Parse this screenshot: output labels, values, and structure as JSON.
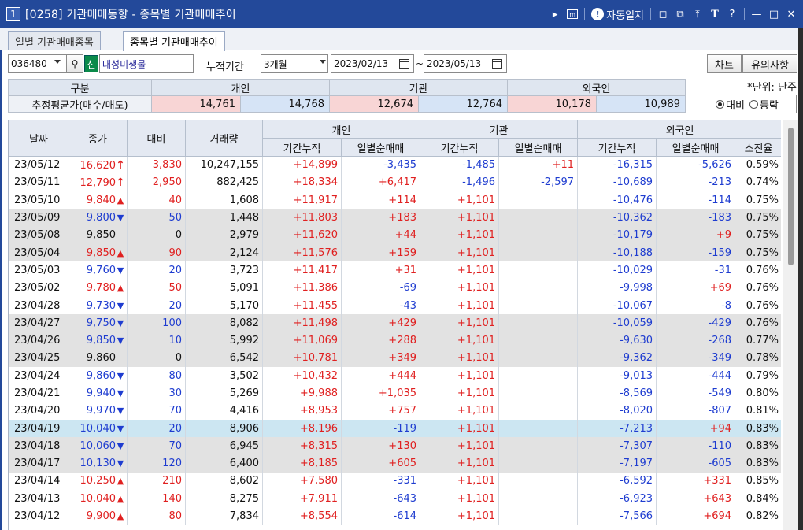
{
  "window": {
    "number": "1",
    "title": "[0258] 기관매매동향 - 종목별 기관매매추이",
    "auto_journal_label": "자동일지",
    "font_label": "T",
    "help_label": "?"
  },
  "tabs": [
    {
      "label": "일별 기관매매종목",
      "active": false
    },
    {
      "label": "종목별 기관매매추이",
      "active": true
    }
  ],
  "controls": {
    "stock_code": "036480",
    "credit_badge": "신",
    "stock_name": "대성미생물",
    "period_label": "누적기간",
    "period_value": "3개월",
    "date_from": "2023/02/13",
    "date_sep": "~",
    "date_to": "2023/05/13",
    "chart_button": "차트",
    "notes_button": "유의사항"
  },
  "summary": {
    "col_header": "구분",
    "row_label": "추정평균가(매수/매도)",
    "groups": [
      "개인",
      "기관",
      "외국인"
    ],
    "values": [
      {
        "buy": "14,761",
        "sell": "14,768"
      },
      {
        "buy": "12,674",
        "sell": "12,764"
      },
      {
        "buy": "10,178",
        "sell": "10,989"
      }
    ],
    "unit": "*단위: 단주",
    "radio_compare": "대비",
    "radio_change": "등락"
  },
  "grid": {
    "headers": {
      "date": "날짜",
      "close": "종가",
      "diff": "대비",
      "volume": "거래량",
      "individual": "개인",
      "institution": "기관",
      "foreign": "외국인",
      "cumulative": "기간누적",
      "daily_net": "일별순매매",
      "exhaustion": "소진율"
    },
    "rows": [
      {
        "date": "23/05/12",
        "close": "16,620",
        "dir": "upper",
        "diff": "3,830",
        "vol": "10,247,155",
        "ind_cum": "+14,899",
        "ind_day": "-3,435",
        "inst_cum": "-1,485",
        "inst_day": "+11",
        "for_cum": "-16,315",
        "for_day": "-5,626",
        "exh": "0.59%",
        "shade": "white"
      },
      {
        "date": "23/05/11",
        "close": "12,790",
        "dir": "upper",
        "diff": "2,950",
        "vol": "882,425",
        "ind_cum": "+18,334",
        "ind_day": "+6,417",
        "inst_cum": "-1,496",
        "inst_day": "-2,597",
        "for_cum": "-10,689",
        "for_day": "-213",
        "exh": "0.74%",
        "shade": "white"
      },
      {
        "date": "23/05/10",
        "close": "9,840",
        "dir": "up",
        "diff": "40",
        "vol": "1,608",
        "ind_cum": "+11,917",
        "ind_day": "+114",
        "inst_cum": "+1,101",
        "inst_day": "",
        "for_cum": "-10,476",
        "for_day": "-114",
        "exh": "0.75%",
        "shade": "white"
      },
      {
        "date": "23/05/09",
        "close": "9,800",
        "dir": "down",
        "diff": "50",
        "vol": "1,448",
        "ind_cum": "+11,803",
        "ind_day": "+183",
        "inst_cum": "+1,101",
        "inst_day": "",
        "for_cum": "-10,362",
        "for_day": "-183",
        "exh": "0.75%",
        "shade": "gray"
      },
      {
        "date": "23/05/08",
        "close": "9,850",
        "dir": "flat",
        "diff": "0",
        "vol": "2,979",
        "ind_cum": "+11,620",
        "ind_day": "+44",
        "inst_cum": "+1,101",
        "inst_day": "",
        "for_cum": "-10,179",
        "for_day": "+9",
        "exh": "0.75%",
        "shade": "gray"
      },
      {
        "date": "23/05/04",
        "close": "9,850",
        "dir": "up",
        "diff": "90",
        "vol": "2,124",
        "ind_cum": "+11,576",
        "ind_day": "+159",
        "inst_cum": "+1,101",
        "inst_day": "",
        "for_cum": "-10,188",
        "for_day": "-159",
        "exh": "0.75%",
        "shade": "gray"
      },
      {
        "date": "23/05/03",
        "close": "9,760",
        "dir": "down",
        "diff": "20",
        "vol": "3,723",
        "ind_cum": "+11,417",
        "ind_day": "+31",
        "inst_cum": "+1,101",
        "inst_day": "",
        "for_cum": "-10,029",
        "for_day": "-31",
        "exh": "0.76%",
        "shade": "white"
      },
      {
        "date": "23/05/02",
        "close": "9,780",
        "dir": "up",
        "diff": "50",
        "vol": "5,091",
        "ind_cum": "+11,386",
        "ind_day": "-69",
        "inst_cum": "+1,101",
        "inst_day": "",
        "for_cum": "-9,998",
        "for_day": "+69",
        "exh": "0.76%",
        "shade": "white"
      },
      {
        "date": "23/04/28",
        "close": "9,730",
        "dir": "down",
        "diff": "20",
        "vol": "5,170",
        "ind_cum": "+11,455",
        "ind_day": "-43",
        "inst_cum": "+1,101",
        "inst_day": "",
        "for_cum": "-10,067",
        "for_day": "-8",
        "exh": "0.76%",
        "shade": "white"
      },
      {
        "date": "23/04/27",
        "close": "9,750",
        "dir": "down",
        "diff": "100",
        "vol": "8,082",
        "ind_cum": "+11,498",
        "ind_day": "+429",
        "inst_cum": "+1,101",
        "inst_day": "",
        "for_cum": "-10,059",
        "for_day": "-429",
        "exh": "0.76%",
        "shade": "gray"
      },
      {
        "date": "23/04/26",
        "close": "9,850",
        "dir": "down",
        "diff": "10",
        "vol": "5,992",
        "ind_cum": "+11,069",
        "ind_day": "+288",
        "inst_cum": "+1,101",
        "inst_day": "",
        "for_cum": "-9,630",
        "for_day": "-268",
        "exh": "0.77%",
        "shade": "gray"
      },
      {
        "date": "23/04/25",
        "close": "9,860",
        "dir": "flat",
        "diff": "0",
        "vol": "6,542",
        "ind_cum": "+10,781",
        "ind_day": "+349",
        "inst_cum": "+1,101",
        "inst_day": "",
        "for_cum": "-9,362",
        "for_day": "-349",
        "exh": "0.78%",
        "shade": "gray"
      },
      {
        "date": "23/04/24",
        "close": "9,860",
        "dir": "down",
        "diff": "80",
        "vol": "3,502",
        "ind_cum": "+10,432",
        "ind_day": "+444",
        "inst_cum": "+1,101",
        "inst_day": "",
        "for_cum": "-9,013",
        "for_day": "-444",
        "exh": "0.79%",
        "shade": "white"
      },
      {
        "date": "23/04/21",
        "close": "9,940",
        "dir": "down",
        "diff": "30",
        "vol": "5,269",
        "ind_cum": "+9,988",
        "ind_day": "+1,035",
        "inst_cum": "+1,101",
        "inst_day": "",
        "for_cum": "-8,569",
        "for_day": "-549",
        "exh": "0.80%",
        "shade": "white"
      },
      {
        "date": "23/04/20",
        "close": "9,970",
        "dir": "down",
        "diff": "70",
        "vol": "4,416",
        "ind_cum": "+8,953",
        "ind_day": "+757",
        "inst_cum": "+1,101",
        "inst_day": "",
        "for_cum": "-8,020",
        "for_day": "-807",
        "exh": "0.81%",
        "shade": "white"
      },
      {
        "date": "23/04/19",
        "close": "10,040",
        "dir": "down",
        "diff": "20",
        "vol": "8,906",
        "ind_cum": "+8,196",
        "ind_day": "-119",
        "inst_cum": "+1,101",
        "inst_day": "",
        "for_cum": "-7,213",
        "for_day": "+94",
        "exh": "0.83%",
        "shade": "selected"
      },
      {
        "date": "23/04/18",
        "close": "10,060",
        "dir": "down",
        "diff": "70",
        "vol": "6,945",
        "ind_cum": "+8,315",
        "ind_day": "+130",
        "inst_cum": "+1,101",
        "inst_day": "",
        "for_cum": "-7,307",
        "for_day": "-110",
        "exh": "0.83%",
        "shade": "gray"
      },
      {
        "date": "23/04/17",
        "close": "10,130",
        "dir": "down",
        "diff": "120",
        "vol": "6,400",
        "ind_cum": "+8,185",
        "ind_day": "+605",
        "inst_cum": "+1,101",
        "inst_day": "",
        "for_cum": "-7,197",
        "for_day": "-605",
        "exh": "0.83%",
        "shade": "gray"
      },
      {
        "date": "23/04/14",
        "close": "10,250",
        "dir": "up",
        "diff": "210",
        "vol": "8,602",
        "ind_cum": "+7,580",
        "ind_day": "-331",
        "inst_cum": "+1,101",
        "inst_day": "",
        "for_cum": "-6,592",
        "for_day": "+331",
        "exh": "0.85%",
        "shade": "white"
      },
      {
        "date": "23/04/13",
        "close": "10,040",
        "dir": "up",
        "diff": "140",
        "vol": "8,275",
        "ind_cum": "+7,911",
        "ind_day": "-643",
        "inst_cum": "+1,101",
        "inst_day": "",
        "for_cum": "-6,923",
        "for_day": "+643",
        "exh": "0.84%",
        "shade": "white"
      },
      {
        "date": "23/04/12",
        "close": "9,900",
        "dir": "up",
        "diff": "80",
        "vol": "7,834",
        "ind_cum": "+8,554",
        "ind_day": "-614",
        "inst_cum": "+1,101",
        "inst_day": "",
        "for_cum": "-7,566",
        "for_day": "+694",
        "exh": "0.82%",
        "shade": "white"
      }
    ]
  },
  "colors": {
    "titlebar": "#23499a",
    "up": "#e02020",
    "down": "#1e3cd0",
    "shade_row": "#e2e2e2",
    "selected_row": "#cce6f2"
  }
}
